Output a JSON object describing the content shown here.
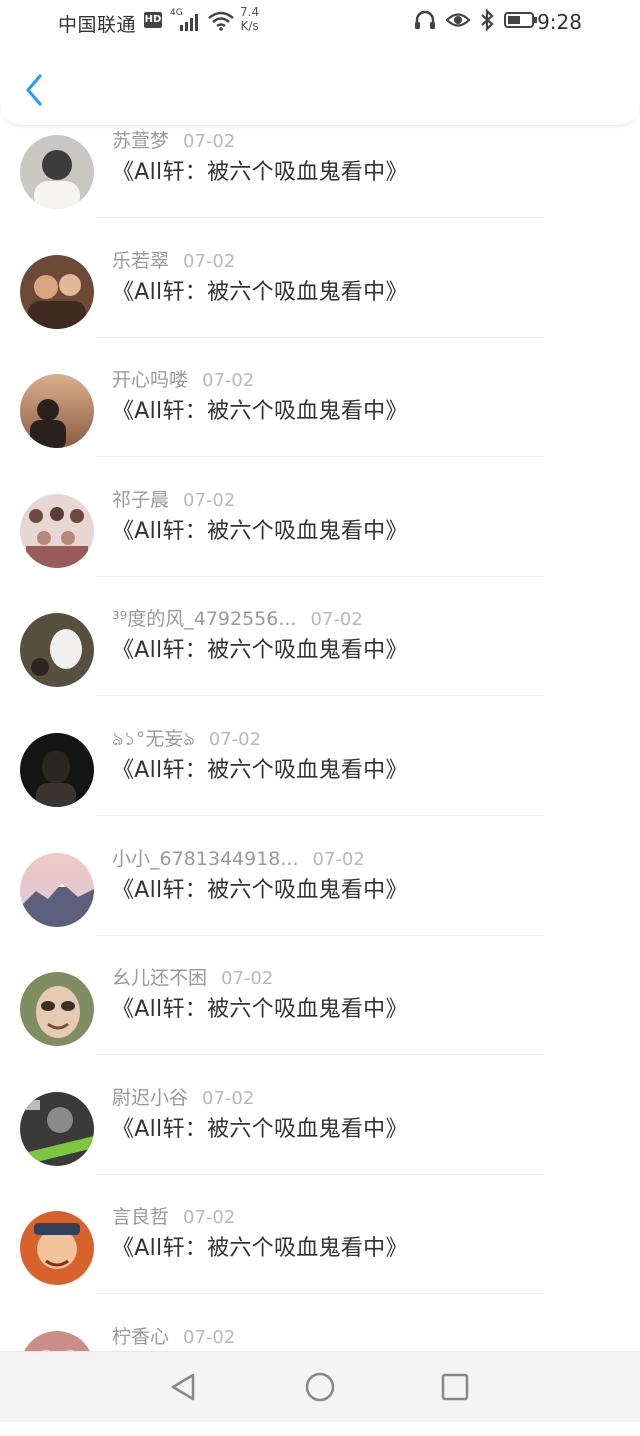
{
  "status_bar": {
    "carrier": "中国联通",
    "hd_badge": "HD",
    "network": "4G",
    "speed_value": "7.4",
    "speed_unit": "K/s",
    "time": "9:28"
  },
  "nav": {
    "back_icon": "chevron-left-icon",
    "accent": "#2a9df4"
  },
  "comments": [
    {
      "user": "苏萱梦",
      "date": "07-02",
      "text": "《All轩：被六个吸血鬼看中》",
      "avatar": {
        "bg": "#c9c7c2",
        "fg": "#f5f4f2"
      }
    },
    {
      "user": "乐若翠",
      "date": "07-02",
      "text": "《All轩：被六个吸血鬼看中》",
      "avatar": {
        "bg": "#6d4a38",
        "fg": "#d9a57f"
      }
    },
    {
      "user": "开心吗喽",
      "date": "07-02",
      "text": "《All轩：被六个吸血鬼看中》",
      "avatar": {
        "bg": "#b07a5a",
        "fg": "#2b211c"
      }
    },
    {
      "user": "祁子晨",
      "date": "07-02",
      "text": "《All轩：被六个吸血鬼看中》",
      "avatar": {
        "bg": "#e7d7d3",
        "fg": "#9a5b5b"
      }
    },
    {
      "user": "³⁹度的风_4792556...",
      "date": "07-02",
      "text": "《All轩：被六个吸血鬼看中》",
      "avatar": {
        "bg": "#58503f",
        "fg": "#f2f0ec"
      }
    },
    {
      "user": "ঌ১°无妄ঌ",
      "date": "07-02",
      "text": "《All轩：被六个吸血鬼看中》",
      "avatar": {
        "bg": "#141414",
        "fg": "#3a3530"
      }
    },
    {
      "user": "小小_6781344918...",
      "date": "07-02",
      "text": "《All轩：被六个吸血鬼看中》",
      "avatar": {
        "bg": "#e9c9c9",
        "fg": "#5b607c"
      }
    },
    {
      "user": "幺儿还不困",
      "date": "07-02",
      "text": "《All轩：被六个吸血鬼看中》",
      "avatar": {
        "bg": "#7f8d63",
        "fg": "#e4cbb2"
      }
    },
    {
      "user": "尉迟小谷",
      "date": "07-02",
      "text": "《All轩：被六个吸血鬼看中》",
      "avatar": {
        "bg": "#3a3a3a",
        "fg": "#7fc63e"
      }
    },
    {
      "user": "言良哲",
      "date": "07-02",
      "text": "《All轩：被六个吸血鬼看中》",
      "avatar": {
        "bg": "#d8622c",
        "fg": "#f3c39c"
      }
    },
    {
      "user": "柠香心",
      "date": "07-02",
      "text": "",
      "avatar": {
        "bg": "#c98f86",
        "fg": "#f1d7cd"
      }
    }
  ],
  "bottom_nav": [
    "back-triangle-icon",
    "home-circle-icon",
    "recents-square-icon"
  ]
}
